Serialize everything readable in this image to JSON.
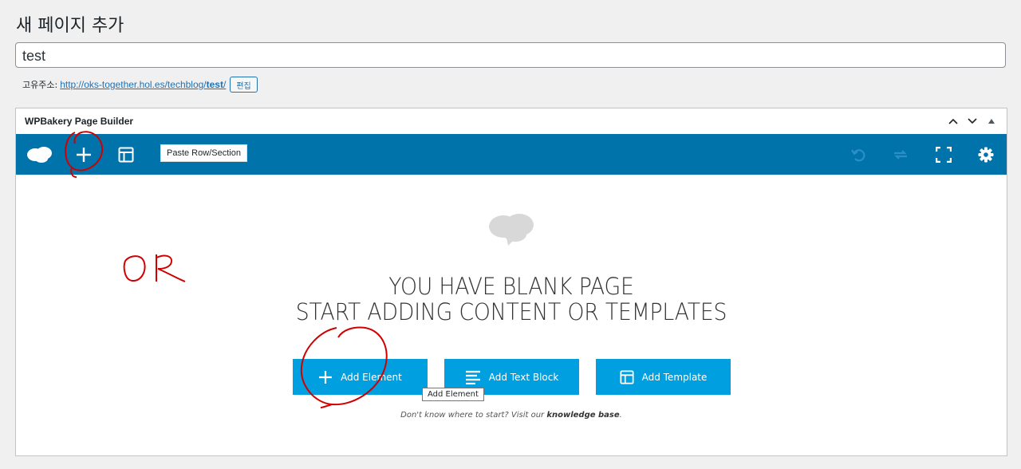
{
  "page": {
    "title": "새 페이지 추가"
  },
  "post_title": {
    "value": "test"
  },
  "permalink": {
    "label": "고유주소:",
    "url_base": "http://oks-together.hol.es/techblog/",
    "slug": "test",
    "trailing": "/",
    "edit_label": "편집"
  },
  "builder": {
    "title": "WPBakery Page Builder",
    "toolbar": {
      "paste_tooltip": "Paste Row/Section",
      "icons": [
        "vc-logo-icon",
        "add-icon",
        "layout-icon",
        "undo-icon",
        "redo-icon",
        "fullscreen-icon",
        "gear-icon"
      ],
      "color": "#0073aa"
    },
    "blank": {
      "line1": "YOU HAVE BLANK PAGE",
      "line2": "START ADDING CONTENT OR TEMPLATES"
    },
    "buttons": {
      "add_element": "Add Element",
      "add_text_block": "Add Text Block",
      "add_template": "Add Template",
      "color": "#00a0e0"
    },
    "add_element_tooltip": "Add Element",
    "help": {
      "prefix": "Don't know where to start? Visit our",
      "link": "knowledge base",
      "suffix": "."
    }
  },
  "annotation": {
    "text": "OR",
    "color": "#d00000"
  }
}
